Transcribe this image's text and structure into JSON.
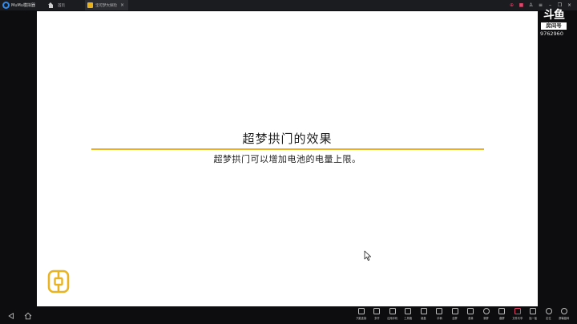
{
  "window": {
    "brand": "MuMu模拟器",
    "tabs": [
      {
        "label": "首页",
        "active": false
      },
      {
        "label": "宝可梦大探险",
        "active": true
      }
    ],
    "controls": [
      "notification-icon",
      "gift-icon",
      "user-icon",
      "menu-icon",
      "minimize-icon",
      "restore-icon",
      "close-icon"
    ]
  },
  "watermark": {
    "logo": "斗鱼",
    "tag": "房间号",
    "room": "9762960"
  },
  "content": {
    "title": "超梦拱门的效果",
    "subtitle": "超梦拱门可以增加电池的电量上限。",
    "accent": "#e8b423"
  },
  "toolbar": {
    "items": [
      {
        "label": "只能连接",
        "icon": "cursor-icon"
      },
      {
        "label": "多开",
        "icon": "multi-window-icon"
      },
      {
        "label": "应用手机",
        "icon": "phone-icon"
      },
      {
        "label": "工具箱",
        "icon": "toolbox-icon"
      },
      {
        "label": "键盘",
        "icon": "keyboard-icon"
      },
      {
        "label": "手柄",
        "icon": "gamepad-icon"
      },
      {
        "label": "全屏",
        "icon": "fullscreen-icon"
      },
      {
        "label": "音量",
        "icon": "volume-icon"
      },
      {
        "label": "录屏",
        "icon": "record-icon"
      },
      {
        "label": "截屏",
        "icon": "screenshot-icon"
      },
      {
        "label": "文件共享",
        "icon": "folder-icon"
      },
      {
        "label": "摇一摇",
        "icon": "shake-icon"
      },
      {
        "label": "定位",
        "icon": "location-icon"
      },
      {
        "label": "屏幕旋转",
        "icon": "rotate-icon"
      }
    ]
  }
}
